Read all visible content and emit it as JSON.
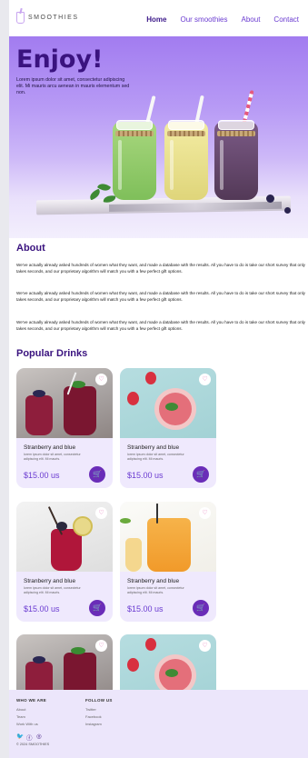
{
  "header": {
    "logo_text": "SMOOTHIES",
    "nav": [
      {
        "label": "Home",
        "active": true
      },
      {
        "label": "Our smoothies",
        "active": false
      },
      {
        "label": "About",
        "active": false
      },
      {
        "label": "Contact",
        "active": false
      }
    ]
  },
  "hero": {
    "title": "Enjoy!",
    "text": "Lorem ipsum dolor sit amet, consectetur adipiscing elit. Mi mauris arcu aenean in mauris elementum sed non."
  },
  "about": {
    "title": "About",
    "paragraphs": [
      "We've actually already asked hundreds of women what they want, and made a database with the results. All you have to do is take our short survey that only takes seconds, and our proprietary algorithm will match you with a few perfect gift options.",
      "We've actually already asked hundreds of women what they want, and made a database with the results. All you have to do is take our short survey that only takes seconds, and our proprietary algorithm will match you with a few perfect gift options.",
      "We've actually already asked hundreds of women what they want, and made a database with the results. All you have to do is take our short survey that only takes seconds, and our proprietary algorithm will match you with a few perfect gift options."
    ]
  },
  "popular": {
    "title": "Popular Drinks",
    "cards": [
      {
        "name": "Stranberry and blue",
        "desc": "lorem ipsum dolor sit amet, consectetur adipiscing elit. Mi mauris.",
        "price": "$15.00 us"
      },
      {
        "name": "Stranberry and blue",
        "desc": "lorem ipsum dolor sit amet, consectetur adipiscing elit. Mi mauris.",
        "price": "$15.00 us"
      },
      {
        "name": "Stranberry and blue",
        "desc": "lorem ipsum dolor sit amet, consectetur adipiscing elit. Mi mauris.",
        "price": "$15.00 us"
      },
      {
        "name": "Stranberry and blue",
        "desc": "lorem ipsum dolor sit amet, consectetur adipiscing elit. Mi mauris.",
        "price": "$15.00 us"
      }
    ]
  },
  "footer": {
    "col1_title": "WHO WE ARE",
    "col1_links": [
      "About",
      "Team",
      "Work With us"
    ],
    "col2_title": "FOLLOW US",
    "col2_links": [
      "Twitter",
      "Facebook",
      "Instagram"
    ],
    "copyright": "© 2024 SMOOTHIES"
  },
  "icons": {
    "heart": "heart-icon",
    "cart": "cart-icon",
    "twitter": "twitter-icon",
    "facebook": "facebook-icon",
    "instagram": "instagram-icon"
  },
  "colors": {
    "accent": "#6a3bd1",
    "heading": "#3a137f",
    "card_bg": "#efe9fd",
    "button": "#6a2db8"
  }
}
